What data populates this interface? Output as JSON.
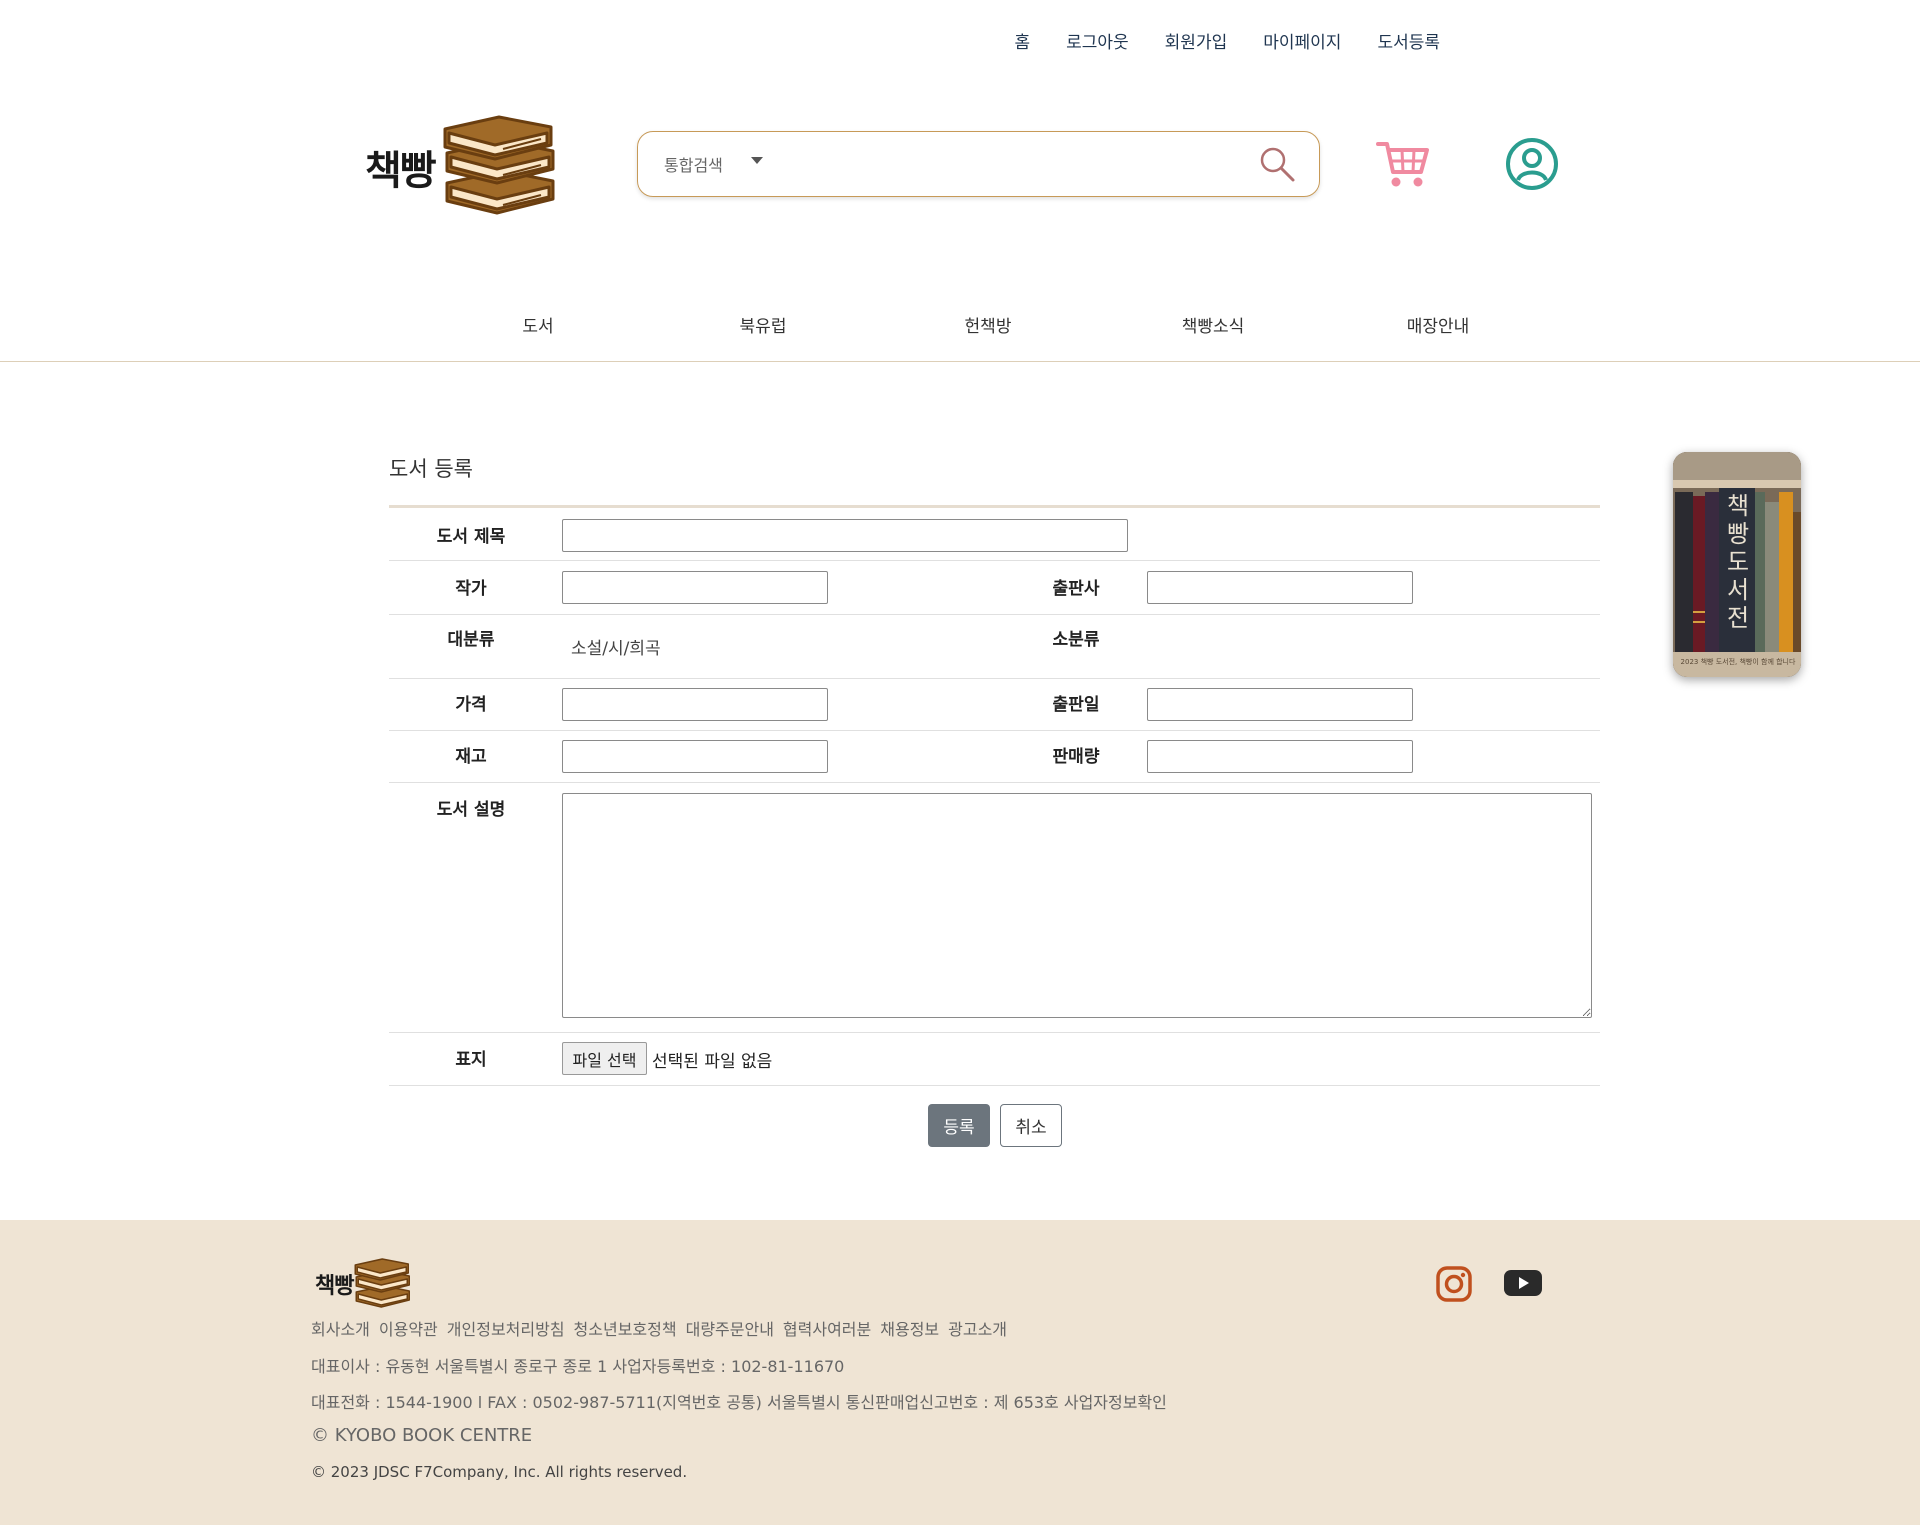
{
  "top_links": [
    "홈",
    "로그아웃",
    "회원가입",
    "마이페이지",
    "도서등록"
  ],
  "logo": {
    "text": "책빵"
  },
  "search": {
    "category": "통합검색",
    "placeholder": ""
  },
  "nav": [
    "도서",
    "북유럽",
    "헌책방",
    "책빵소식",
    "매장안내"
  ],
  "form": {
    "title": "도서 등록",
    "labels": {
      "book_title": "도서 제목",
      "author": "작가",
      "publisher": "출판사",
      "major_category": "대분류",
      "minor_category": "소분류",
      "price": "가격",
      "publish_date": "출판일",
      "stock": "재고",
      "sales": "판매량",
      "description": "도서 설명",
      "cover": "표지"
    },
    "major_category_value": "소설/시/희곡",
    "file_button": "파일 선택",
    "file_status": "선택된 파일 없음",
    "submit": "등록",
    "cancel": "취소"
  },
  "side_banner": {
    "title": "책빵도서전",
    "caption": "2023 책빵 도서전, 책빵이 함께 합니다"
  },
  "footer": {
    "logo_text": "책빵",
    "links": [
      "회사소개",
      "이용약관",
      "개인정보처리방침",
      "청소년보호정책",
      "대량주문안내",
      "협력사여러분",
      "채용정보",
      "광고소개"
    ],
    "line1": "대표이사 : 유동현 서울특별시 종로구 종로 1 사업자등록번호 : 102-81-11670",
    "line2": "대표전화 : 1544-1900 l FAX : 0502-987-5711(지역번호 공통) 서울특별시 통신판매업신고번호 : 제 653호 사업자정보확인",
    "line3": "© KYOBO BOOK CENTRE",
    "line4": "© 2023 JDSC F7Company, Inc. All rights reserved."
  },
  "colors": {
    "accent_border": "#c79a58",
    "cart": "#f08aa0",
    "user": "#2a9d8f",
    "footer_bg": "#efe4d4",
    "instagram": "#c0501e"
  }
}
